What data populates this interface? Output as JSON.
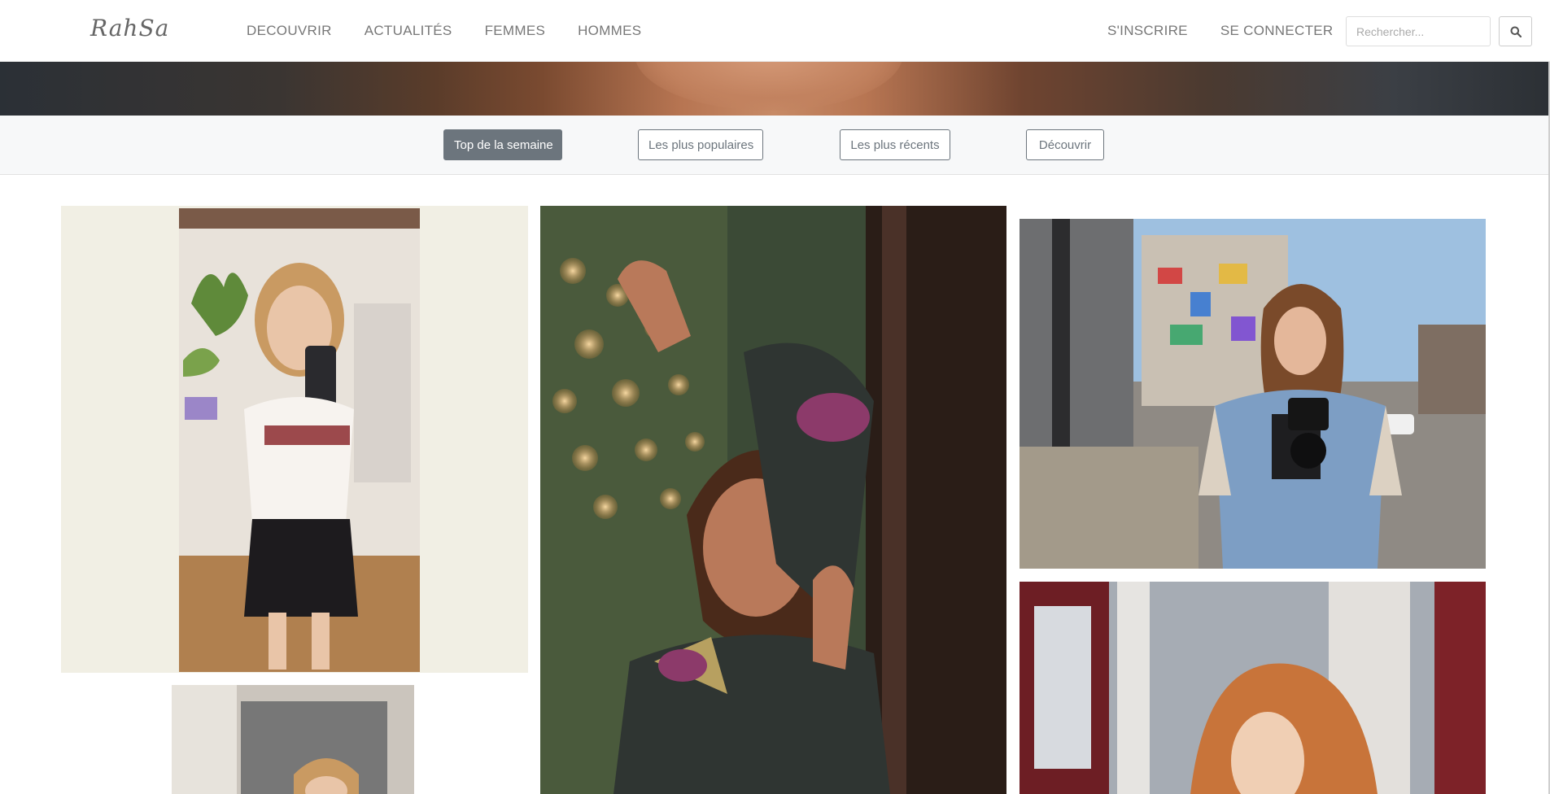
{
  "brand": {
    "logo_text": "RahSa"
  },
  "nav": {
    "items": [
      {
        "label": "DECOUVRIR"
      },
      {
        "label": "ACTUALITÉS"
      },
      {
        "label": "FEMMES"
      },
      {
        "label": "HOMMES"
      }
    ],
    "signup_label": "S'INSCRIRE",
    "login_label": "SE CONNECTER"
  },
  "search": {
    "placeholder": "Rechercher...",
    "icon": "search-icon"
  },
  "filters": [
    {
      "label": "Top de la semaine",
      "active": true
    },
    {
      "label": "Les plus populaires",
      "active": false
    },
    {
      "label": "Les plus récents",
      "active": false
    },
    {
      "label": "Découvrir",
      "active": false
    }
  ],
  "colors": {
    "accent": "#6c757d",
    "nav_text": "#777777",
    "filter_bar_bg": "#f7f8f9"
  }
}
